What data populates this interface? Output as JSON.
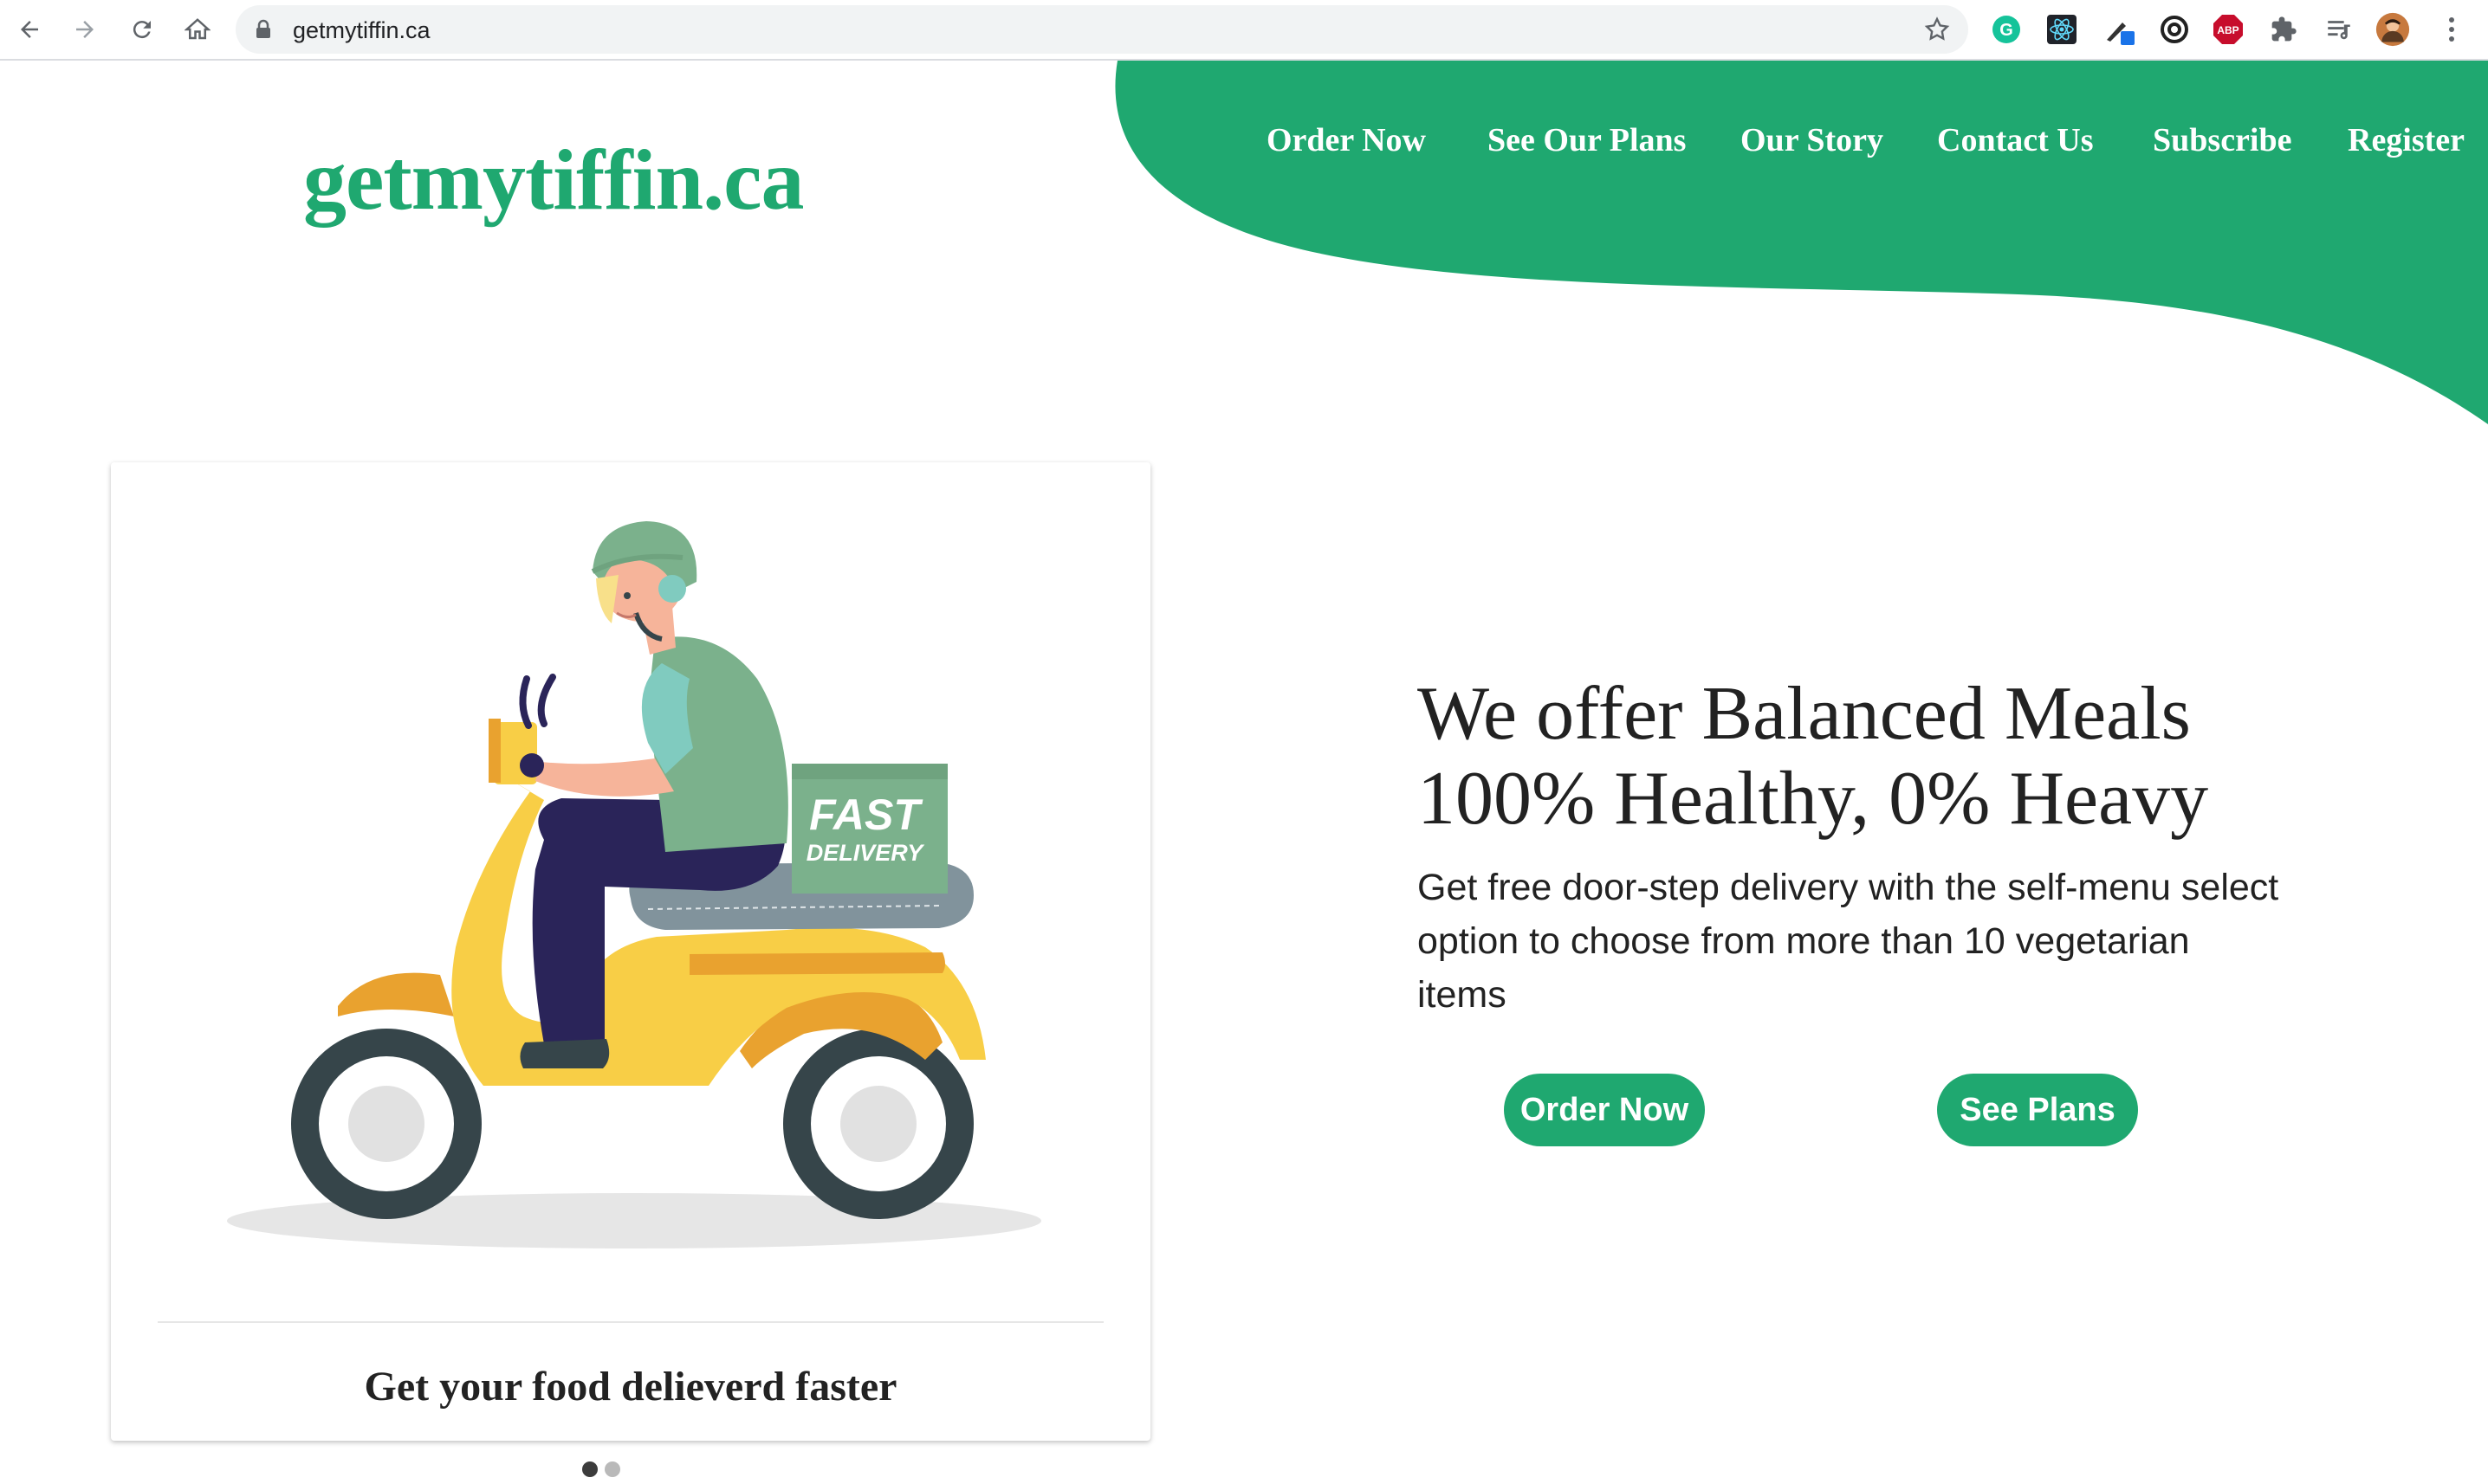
{
  "browser": {
    "url": "getmytiffin.ca",
    "back_icon": "arrow-left-icon",
    "forward_icon": "arrow-right-icon",
    "reload_icon": "reload-icon",
    "home_icon": "home-icon",
    "extensions": [
      "grammarly-icon",
      "react-devtools-icon",
      "color-picker-icon",
      "extension-icon",
      "adblock-icon",
      "puzzle-icon",
      "reading-list-icon",
      "avatar",
      "menu-dots-icon"
    ],
    "adblock_label": "ABP",
    "grammarly_label": "G"
  },
  "site": {
    "logo": "getmytiffin.ca",
    "nav": [
      "Order Now",
      "See Our Plans",
      "Our Story",
      "Contact Us",
      "Subscribe",
      "Register"
    ],
    "brand_color": "#1fa870"
  },
  "card": {
    "badge_title": "FAST",
    "badge_sub": "DELIVERY",
    "caption": "Get your food delieverd faster",
    "carousel_index": 1,
    "carousel_count": 2
  },
  "hero": {
    "headline_line1": "We offer Balanced Meals",
    "headline_line2": "100% Healthy, 0% Heavy",
    "subtext": "Get free door-step delivery with the self-menu select option to choose from more than 10 vegetarian items",
    "cta_primary": "Order Now",
    "cta_secondary": "See Plans"
  }
}
